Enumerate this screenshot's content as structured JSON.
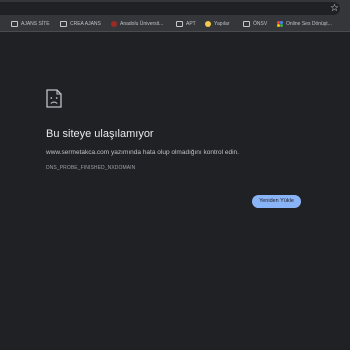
{
  "browser": {
    "bookmarks": [
      {
        "label": "AJANS SİTE",
        "icon": "folder-icon"
      },
      {
        "label": "CREA AJANS",
        "icon": "folder-icon"
      },
      {
        "label": "Anadolu Üniversit...",
        "icon": "anadolu-logo-icon"
      },
      {
        "label": "APT",
        "icon": "folder-icon"
      },
      {
        "label": "Yapılar",
        "icon": "smiley-icon"
      },
      {
        "label": "ÖNSV",
        "icon": "folder-icon"
      },
      {
        "label": "Online Ses Dönüşt...",
        "icon": "color-dots-icon"
      }
    ]
  },
  "error_page": {
    "title": "Bu siteye ulaşılamıyor",
    "domain": "www.sermetakca.com",
    "description_suffix": " yazımında hata olup olmadığını kontrol edin.",
    "error_code": "DNS_PROBE_FINISHED_NXDOMAIN",
    "reload_label": "Yeniden Yükle"
  },
  "colors": {
    "background": "#202124",
    "button": "#8ab4f8"
  }
}
